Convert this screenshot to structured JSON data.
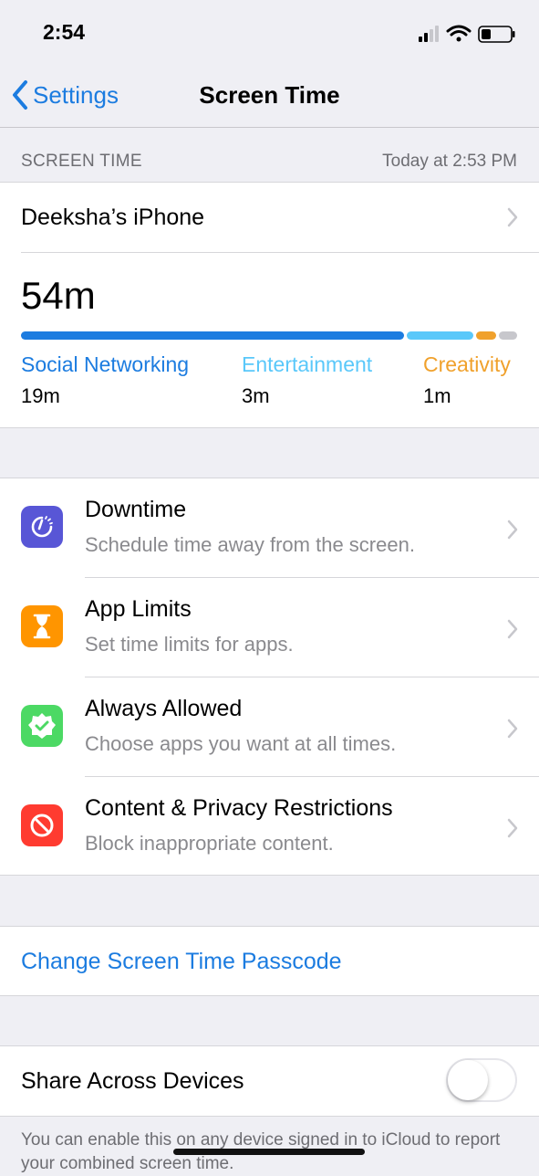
{
  "status": {
    "time": "2:54"
  },
  "nav": {
    "back_label": "Settings",
    "title": "Screen Time"
  },
  "section": {
    "header": "SCREEN TIME",
    "updated": "Today at 2:53 PM"
  },
  "device": {
    "name": "Deeksha’s iPhone"
  },
  "usage": {
    "total": "54m",
    "categories": [
      {
        "name": "Social Networking",
        "time": "19m",
        "color": "#1c7ce0"
      },
      {
        "name": "Entertainment",
        "time": "3m",
        "color": "#5ac8fa"
      },
      {
        "name": "Creativity",
        "time": "1m",
        "color": "#f0a12c"
      }
    ],
    "other_color": "#c7c7cc"
  },
  "menu": [
    {
      "title": "Downtime",
      "subtitle": "Schedule time away from the screen.",
      "icon": "downtime-icon",
      "color": "#5856d6"
    },
    {
      "title": "App Limits",
      "subtitle": "Set time limits for apps.",
      "icon": "hourglass-icon",
      "color": "#ff9500"
    },
    {
      "title": "Always Allowed",
      "subtitle": "Choose apps you want at all times.",
      "icon": "checkmark-seal-icon",
      "color": "#4cd964"
    },
    {
      "title": "Content & Privacy Restrictions",
      "subtitle": "Block inappropriate content.",
      "icon": "restriction-icon",
      "color": "#ff3b30"
    }
  ],
  "passcode": {
    "label": "Change Screen Time Passcode"
  },
  "share": {
    "label": "Share Across Devices",
    "enabled": false
  },
  "footer": {
    "text": "You can enable this on any device signed in to iCloud to report your combined screen time."
  }
}
